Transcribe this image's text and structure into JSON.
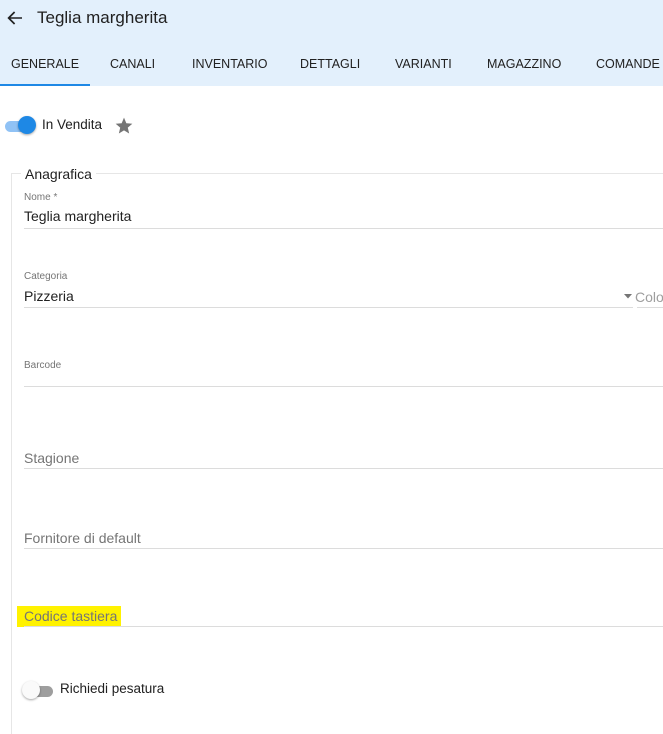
{
  "header": {
    "back_icon": "arrow-left-icon",
    "title": "Teglia margherita"
  },
  "tabs": [
    {
      "label": "GENERALE",
      "active": true
    },
    {
      "label": "CANALI",
      "active": false
    },
    {
      "label": "INVENTARIO",
      "active": false
    },
    {
      "label": "DETTAGLI",
      "active": false
    },
    {
      "label": "VARIANTI",
      "active": false
    },
    {
      "label": "MAGAZZINO",
      "active": false
    },
    {
      "label": "COMANDE",
      "active": false
    }
  ],
  "sale_toggle": {
    "label": "In Vendita",
    "checked": true
  },
  "favorite_icon": "star-icon",
  "section": {
    "legend": "Anagrafica"
  },
  "fields": {
    "nome": {
      "label": "Nome *",
      "value": "Teglia margherita"
    },
    "categoria": {
      "label": "Categoria",
      "value": "Pizzeria",
      "side_label": "Colo"
    },
    "barcode": {
      "label": "Barcode",
      "value": ""
    },
    "stagione": {
      "placeholder": "Stagione"
    },
    "fornitore": {
      "placeholder": "Fornitore di default"
    },
    "codice_tastiera": {
      "placeholder": "Codice tastiera",
      "highlighted": true
    }
  },
  "weigh_toggle": {
    "label": "Richiedi pesatura",
    "checked": false
  },
  "colors": {
    "header_bg": "#e3f0fc",
    "accent": "#1e88e5",
    "highlight": "#fff200"
  }
}
